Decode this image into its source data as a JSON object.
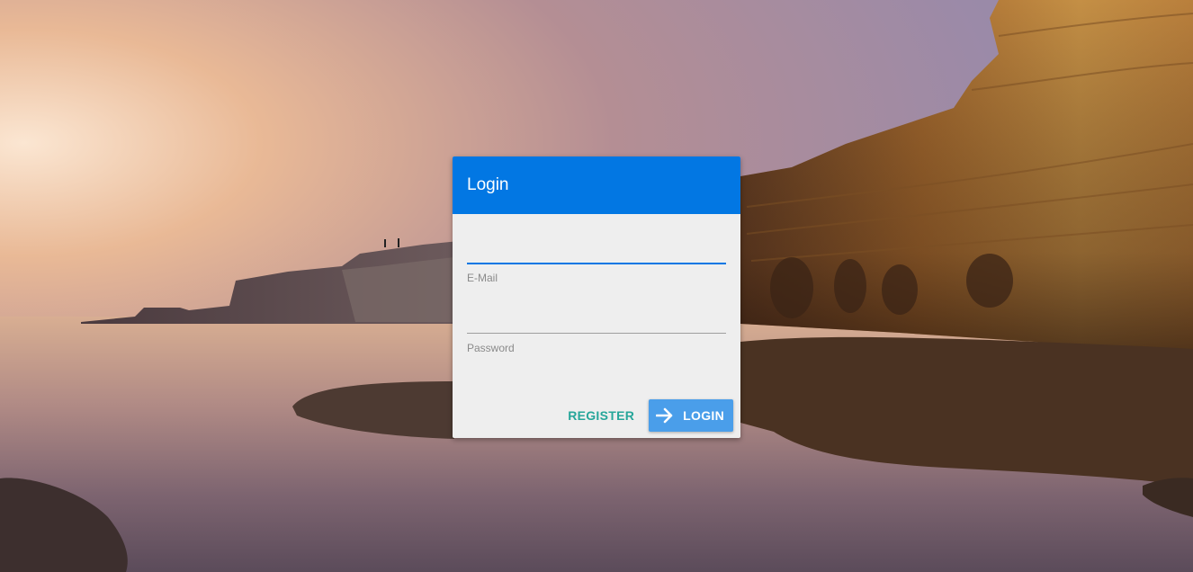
{
  "dialog": {
    "title": "Login",
    "email": {
      "label": "E-Mail",
      "value": "",
      "placeholder": ""
    },
    "password": {
      "label": "Password",
      "value": "",
      "placeholder": ""
    },
    "actions": {
      "register_label": "REGISTER",
      "login_label": "LOGIN",
      "login_icon": "arrow-right-icon"
    }
  },
  "colors": {
    "header": "#0277e3",
    "login_button": "#4a9eea",
    "register_text": "#26a69a",
    "card_bg": "#eeeeee"
  }
}
